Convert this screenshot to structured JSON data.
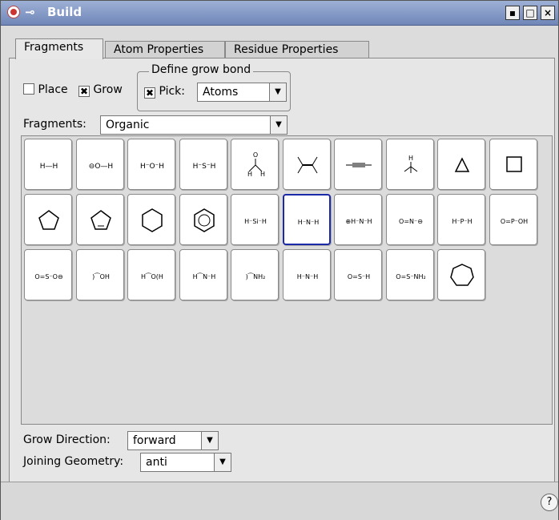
{
  "window": {
    "title": "Build",
    "min_label": "▪",
    "max_label": "□",
    "close_label": "×"
  },
  "tabs": [
    {
      "label": "Fragments"
    },
    {
      "label": "Atom Properties"
    },
    {
      "label": "Residue Properties"
    }
  ],
  "options": {
    "place_label": "Place",
    "place_checked": false,
    "grow_label": "Grow",
    "grow_checked": true
  },
  "grow_bond": {
    "group_title": "Define grow bond",
    "pick_label": "Pick:",
    "pick_checked": true,
    "pick_value": "Atoms"
  },
  "fragments": {
    "label": "Fragments:",
    "category": "Organic",
    "selected_index": 15,
    "items": [
      "hydrogen",
      "hydroxide",
      "water",
      "hydrogen-sulfide",
      "formaldehyde",
      "ethylene",
      "acetylene",
      "methane",
      "triangle-cyclopropane",
      "square-cyclobutane",
      "cyclopentane",
      "cyclopentadiene",
      "cyclohexane",
      "benzene",
      "silane",
      "ammonia",
      "ammonium",
      "nitro",
      "phosphine",
      "phosphonate",
      "sulfonate",
      "carboxylic-acid",
      "ester",
      "amide",
      "carboxamide",
      "amine",
      "sulfoxide",
      "sulfinamide",
      "cycloheptane"
    ]
  },
  "grow_direction": {
    "label": "Grow Direction:",
    "value": "forward"
  },
  "joining_geometry": {
    "label": "Joining Geometry:",
    "value": "anti"
  },
  "help": "?"
}
